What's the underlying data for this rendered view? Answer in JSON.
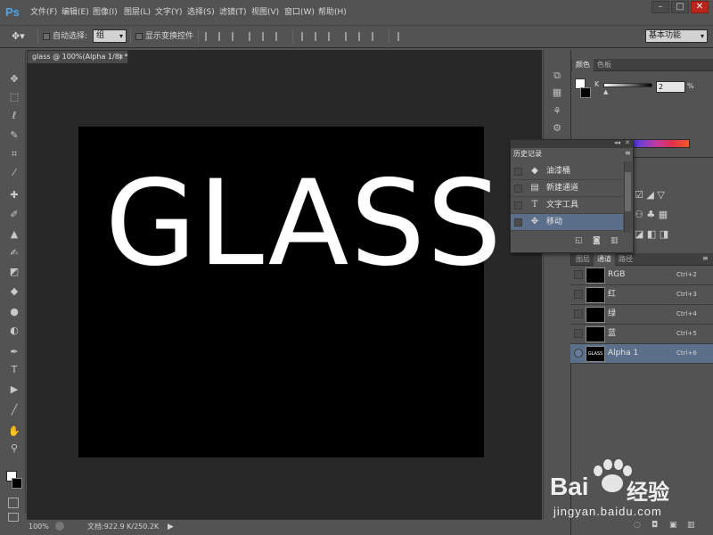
{
  "app": {
    "logo": "Ps"
  },
  "menu": [
    "文件(F)",
    "编辑(E)",
    "图像(I)",
    "图层(L)",
    "文字(Y)",
    "选择(S)",
    "滤镜(T)",
    "视图(V)",
    "窗口(W)",
    "帮助(H)"
  ],
  "window_controls": {
    "minimize": "–",
    "maximize": "□",
    "close": "✕"
  },
  "options": {
    "auto_select_label": "自动选择:",
    "auto_select_value": "组",
    "show_transform_label": "显示变换控件",
    "workspace": "基本功能"
  },
  "document": {
    "tab_title": "glass @ 100%(Alpha 1/8) *",
    "tab_close": "×",
    "canvas_text": "GLASS"
  },
  "status": {
    "zoom": "100%",
    "doc_info": "文档:922.9 K/250.2K"
  },
  "color_panel": {
    "tabs": [
      "颜色",
      "色板"
    ],
    "channel_letter": "K",
    "value": "2",
    "unit": "%",
    "k_percent": 2
  },
  "history_panel": {
    "title": "历史记录",
    "items": [
      {
        "label": "油漆桶",
        "icon": "paint-bucket-icon",
        "glyph": "◆"
      },
      {
        "label": "新建通道",
        "icon": "new-channel-icon",
        "glyph": "▤"
      },
      {
        "label": "文字工具",
        "icon": "type-tool-icon",
        "glyph": "T"
      },
      {
        "label": "移动",
        "icon": "move-tool-icon",
        "glyph": "✥"
      }
    ],
    "selected_index": 3
  },
  "layers_panel": {
    "tabs": [
      "图层",
      "通道",
      "路径"
    ],
    "active_tab": "通道",
    "channels": [
      {
        "name": "RGB",
        "shortcut": "Ctrl+2",
        "thumb": ""
      },
      {
        "name": "红",
        "shortcut": "Ctrl+3",
        "thumb": ""
      },
      {
        "name": "绿",
        "shortcut": "Ctrl+4",
        "thumb": ""
      },
      {
        "name": "蓝",
        "shortcut": "Ctrl+5",
        "thumb": ""
      },
      {
        "name": "Alpha 1",
        "shortcut": "Ctrl+6",
        "thumb": "GLASS"
      }
    ],
    "selected_channel": "Alpha 1"
  },
  "watermark": {
    "brand": "Bai",
    "brand_tail": "经验",
    "url": "jingyan.baidu.com"
  },
  "colors": {
    "ui_bg": "#535353",
    "doc_bg": "#282828",
    "selection": "#5c6f8a",
    "ps_blue": "#4fa3e8"
  }
}
